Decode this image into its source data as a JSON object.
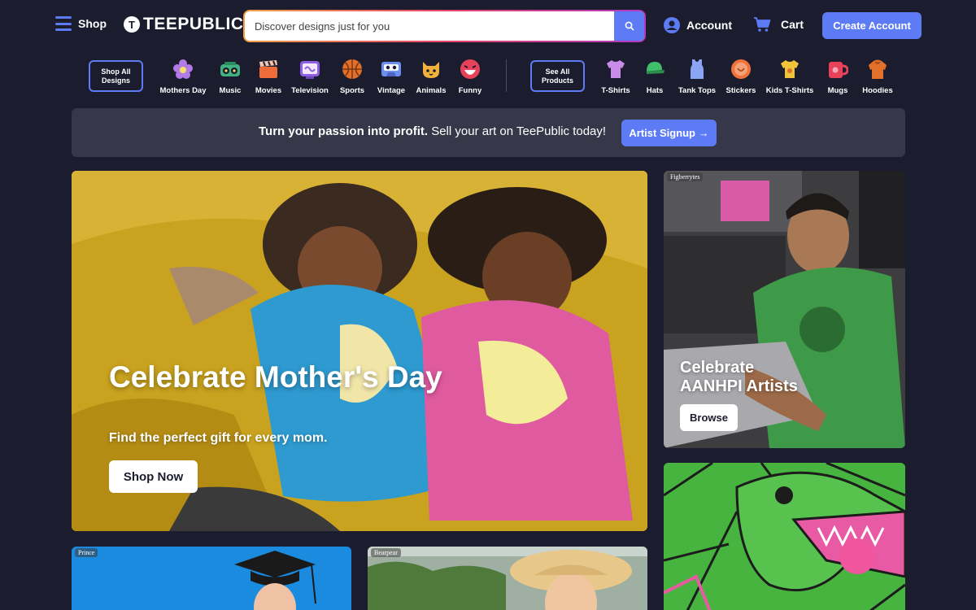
{
  "header": {
    "menu_label": "Shop",
    "logo_text": "TEEPUBLIC",
    "search_placeholder": "Discover designs just for you",
    "account_label": "Account",
    "cart_label": "Cart",
    "create_account_label": "Create Account"
  },
  "categories": {
    "shop_all_label": "Shop All Designs",
    "see_all_label": "See All Products",
    "designs": [
      {
        "label": "Mothers Day",
        "icon": "flower-icon",
        "color": "#b27be8"
      },
      {
        "label": "Music",
        "icon": "boombox-icon",
        "color": "#3fb27f"
      },
      {
        "label": "Movies",
        "icon": "clapperboard-icon",
        "color": "#f06b3a"
      },
      {
        "label": "Television",
        "icon": "tv-icon",
        "color": "#8e5fe0"
      },
      {
        "label": "Sports",
        "icon": "ball-icon",
        "color": "#e0702a"
      },
      {
        "label": "Vintage",
        "icon": "cassette-icon",
        "color": "#6d8ef0"
      },
      {
        "label": "Animals",
        "icon": "cat-icon",
        "color": "#f0b23a"
      },
      {
        "label": "Funny",
        "icon": "laughing-face-icon",
        "color": "#e8415a"
      }
    ],
    "products": [
      {
        "label": "T-Shirts",
        "icon": "tshirt-icon",
        "color": "#c88ce8"
      },
      {
        "label": "Hats",
        "icon": "cap-icon",
        "color": "#3fbf6a"
      },
      {
        "label": "Tank Tops",
        "icon": "tank-top-icon",
        "color": "#8ba5f5"
      },
      {
        "label": "Stickers",
        "icon": "sticker-icon",
        "color": "#f0743a"
      },
      {
        "label": "Kids T-Shirts",
        "icon": "kids-tshirt-icon",
        "color": "#f0c43a"
      },
      {
        "label": "Mugs",
        "icon": "mug-icon",
        "color": "#e8415a"
      },
      {
        "label": "Hoodies",
        "icon": "hoodie-icon",
        "color": "#e0702a"
      }
    ]
  },
  "promo": {
    "bold_text": "Turn your passion into profit.",
    "text": " Sell your art on TeePublic today!",
    "button_label": "Artist Signup →"
  },
  "hero": {
    "title": "Celebrate Mother's Day",
    "subtitle": "Find the perfect gift for every mom.",
    "button_label": "Shop Now"
  },
  "aanhpi_card": {
    "artist_tag": "Figberrytes",
    "title": "Celebrate AANHPI Artists",
    "button_label": "Browse"
  },
  "bottom_cards": {
    "grad_tag": "Prince",
    "hat_tag": "Bearpear"
  },
  "colors": {
    "background": "#1b1c2d",
    "accent": "#5d7bf5",
    "promo_bg": "#363748"
  }
}
